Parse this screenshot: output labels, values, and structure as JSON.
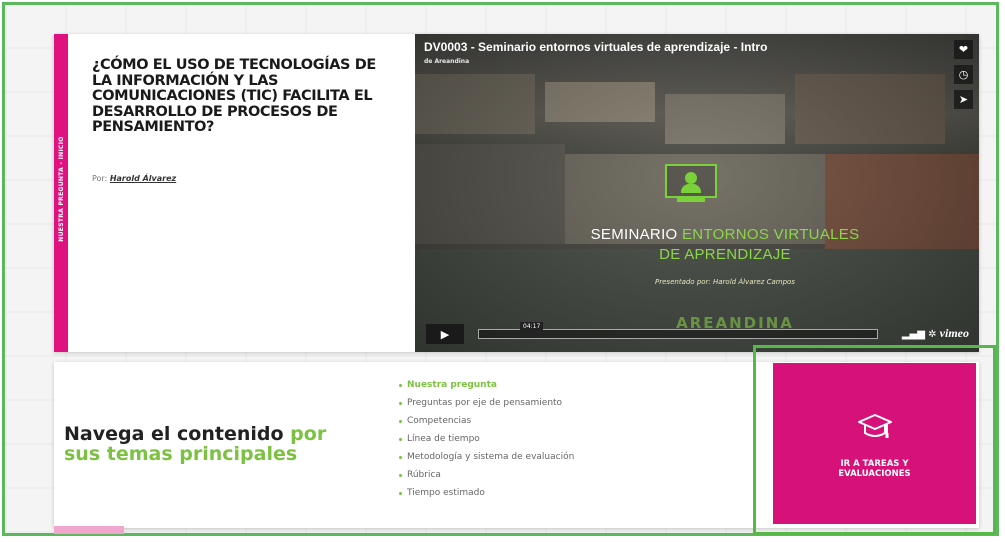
{
  "question": {
    "side_tab": "NUESTRA PREGUNTA - INICIO",
    "title": "¿CÓMO EL USO DE TECNOLOGÍAS DE LA INFORMACIÓN Y LAS COMUNICACIONES (TIC) FACILITA EL DESARROLLO DE PROCESOS DE PENSAMIENTO?",
    "by_prefix": "Por: ",
    "author": "Harold Álvarez"
  },
  "video": {
    "title": "DV0003 - Seminario entornos virtuales de aprendizaje - Intro",
    "owner": "de Areandina",
    "seminar_white": "SEMINARIO ",
    "seminar_green": "ENTORNOS VIRTUALES",
    "seminar_line2": "DE APRENDIZAJE",
    "presenter": "Presentado por: Harold Álvarez Campos",
    "areandina": "AREANDINA",
    "time": "04:17",
    "brand": "vimeo",
    "icons": [
      "heart-icon",
      "clock-icon",
      "send-icon",
      "play-icon",
      "volume-icon",
      "settings-icon"
    ]
  },
  "navigation": {
    "heading_dark": "Navega el contenido ",
    "heading_green_1": "por",
    "heading_green_2": "sus temas principales",
    "topics": [
      "Nuestra pregunta",
      "Preguntas por eje de pensamiento",
      "Competencias",
      "Línea de tiempo",
      "Metodología y sistema de evaluación",
      "Rúbrica",
      "Tiempo estimado"
    ]
  },
  "cta": {
    "line1": "IR A TAREAS Y",
    "line2": "EVALUACIONES",
    "icon": "graduation-cap-icon"
  },
  "colors": {
    "magenta": "#d6117a",
    "green": "#7cc242",
    "frame_green": "#55b847"
  }
}
